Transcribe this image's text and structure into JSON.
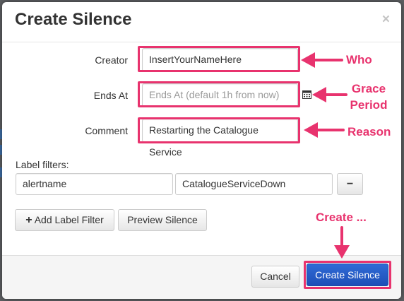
{
  "dialog": {
    "title": "Create Silence",
    "close_glyph": "×"
  },
  "form": {
    "creator": {
      "label": "Creator",
      "value": "InsertYourNameHere"
    },
    "ends_at": {
      "label": "Ends At",
      "placeholder": "Ends At (default 1h from now)",
      "icon": "calendar-icon"
    },
    "comment": {
      "label": "Comment",
      "value": "Restarting the Catalogue Service"
    }
  },
  "label_filters": {
    "heading": "Label filters:",
    "rows": [
      {
        "name": "alertname",
        "value": "CatalogueServiceDown"
      }
    ],
    "remove_glyph": "−"
  },
  "actions": {
    "add_label_filter": "Add Label Filter",
    "add_glyph": "+",
    "preview_silence": "Preview Silence"
  },
  "footer": {
    "cancel": "Cancel",
    "create": "Create Silence"
  },
  "annotations": {
    "who": "Who",
    "grace_line1": "Grace",
    "grace_line2": "Period",
    "reason": "Reason",
    "create": "Create ..."
  },
  "colors": {
    "highlight": "#e8336e",
    "primary": "#2563d0",
    "overlay": "#5e6063"
  }
}
